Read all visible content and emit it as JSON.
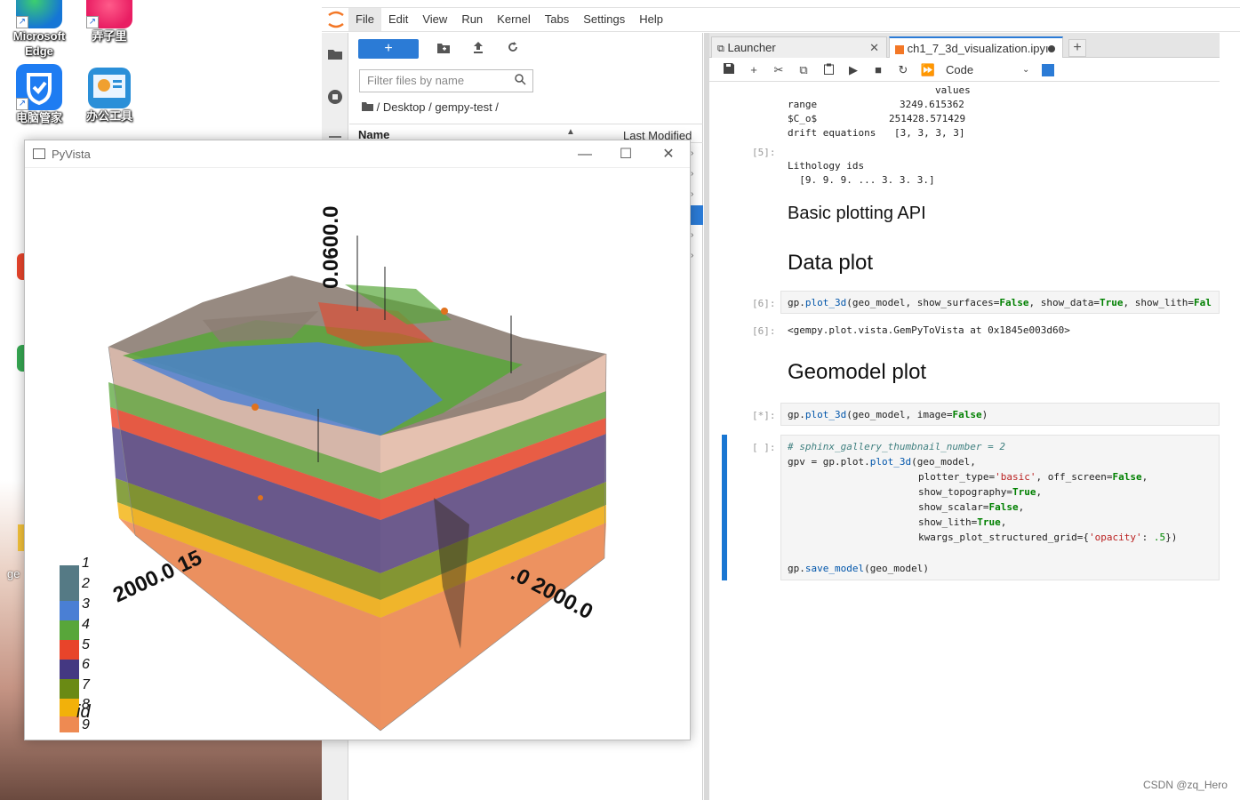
{
  "desktop": {
    "icons": [
      {
        "label": "Microsoft Edge",
        "line1": "Microsoft",
        "line2": "Edge"
      },
      {
        "label": "弄子里",
        "line1": "弄子里",
        "line2": ""
      },
      {
        "label": "电脑管家",
        "line1": "电脑管家",
        "line2": ""
      },
      {
        "label": "办公工具",
        "line1": "办公工具",
        "line2": ""
      }
    ],
    "fragment_ge": "ge"
  },
  "jupyter": {
    "menu": [
      "File",
      "Edit",
      "View",
      "Run",
      "Kernel",
      "Tabs",
      "Settings",
      "Help"
    ],
    "filebrowser": {
      "new_button": "+",
      "filter_placeholder": "Filter files by name",
      "breadcrumb": "/ Desktop / gempy-test /",
      "col_name": "Name",
      "col_modified": "Last Modified"
    },
    "tabs": [
      {
        "label": "Launcher"
      },
      {
        "label": "ch1_7_3d_visualization.ipyı"
      }
    ],
    "toolbar": {
      "cell_type": "Code"
    },
    "notebook": {
      "top_output": {
        "header": "values",
        "rows": [
          {
            "key": "range",
            "val": "3249.615362"
          },
          {
            "key": "$C_o$",
            "val": "251428.571429"
          },
          {
            "key": "drift equations",
            "val": "[3, 3, 3, 3]"
          }
        ]
      },
      "cell5_prompt": "[5]:",
      "cell5_out_1": "Lithology ids",
      "cell5_out_2": "  [9. 9. 9. ... 3. 3. 3.]",
      "md_basic": "Basic plotting API",
      "md_data": "Data plot",
      "cell6_prompt": "[6]:",
      "cell6_out_prompt": "[6]:",
      "cell6_out": "<gempy.plot.vista.GemPyToVista at 0x1845e003d60>",
      "md_geomodel": "Geomodel plot",
      "cell_run_prompt": "[*]:",
      "cell_empty_prompt": "[ ]:"
    }
  },
  "pyvista": {
    "title": "PyVista",
    "axis_z_label": "0.0600.0",
    "axis_x_label": "2000.0 15",
    "axis_y_label": ".0 2000.0",
    "legend": [
      "1",
      "2",
      "3",
      "4",
      "5",
      "6",
      "7",
      "8",
      "9"
    ],
    "legend_overlap": "id",
    "legend_colors": [
      "#557a85",
      "#4a7fd4",
      "#58a63a",
      "#e8442a",
      "#443882",
      "#6a8a14",
      "#f2b10a",
      "#ee8a52",
      "#ee8a52"
    ]
  },
  "watermark": "CSDN @zq_Hero"
}
